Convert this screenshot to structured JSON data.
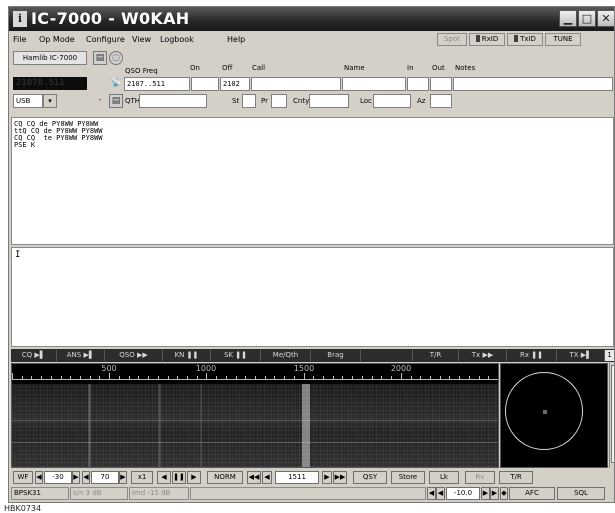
{
  "window": {
    "title": "IC-7000 - W0KAH",
    "app_icon": "i"
  },
  "menu": {
    "items": [
      "File",
      "Op Mode",
      "Configure",
      "View",
      "Logbook",
      "Help"
    ],
    "mode_buttons": {
      "spot": "Spot",
      "rxid": "RxID",
      "txid": "TxID",
      "tune": "TUNE"
    }
  },
  "rig": {
    "hamlib_label": "Hamlib IC-7000",
    "frequency_display": "21070.511",
    "mode": "USB",
    "mode_dropdown_icon": "chevron-down-icon",
    "minus_label": "-"
  },
  "log": {
    "headers": {
      "qso_freq": "QSO Freq",
      "on": "On",
      "off": "Off",
      "call": "Call",
      "name": "Name",
      "in": "In",
      "out": "Out",
      "notes": "Notes"
    },
    "values": {
      "qso_freq": "2107..511",
      "on": "",
      "off": "2102",
      "call": "",
      "name": "",
      "in": "",
      "out": "",
      "notes": ""
    },
    "row2_labels": {
      "qth": "QTH",
      "st": "St",
      "pr": "Pr",
      "cnty": "Cnty",
      "loc": "Loc",
      "az": "Az"
    },
    "row2_values": {
      "qth": "",
      "st": "",
      "pr": "",
      "cnty": "",
      "loc": "",
      "az": ""
    }
  },
  "rx_text": [
    "CQ CQ de PY8WW PY8WW",
    "ttQ CQ de PY8WW PY8WW",
    "CQ CQ  te PY8WW PY8WW",
    "PSE K"
  ],
  "tx_text": "I",
  "macros": [
    "CQ",
    "ANS",
    "QSO",
    "KN",
    "SK",
    "Me/Qth",
    "Brag",
    "",
    "T/R",
    "Tx",
    "Rx",
    "TX",
    "1"
  ],
  "waterfall": {
    "scale_labels": [
      "500",
      "1000",
      "1500",
      "2000"
    ],
    "scale_values": [
      500,
      1000,
      1500,
      2000
    ],
    "scale_max": 2500,
    "signal_hz": 1511
  },
  "controls": {
    "wf_label": "WF",
    "wf_ref": "-30",
    "wf_range": "70",
    "zoom": "x1",
    "norm": "NORM",
    "freq": "1511",
    "qsy": "QSY",
    "store": "Store",
    "lk": "Lk",
    "rv": "Rv",
    "tr": "T/R"
  },
  "status": {
    "mode": "BPSK31",
    "s_n": "s/n  3 dB",
    "imd": "imd -15 dB",
    "squelch_level": "-10.0",
    "afc": "AFC",
    "sql": "SQL"
  },
  "caption": "HBK0734"
}
